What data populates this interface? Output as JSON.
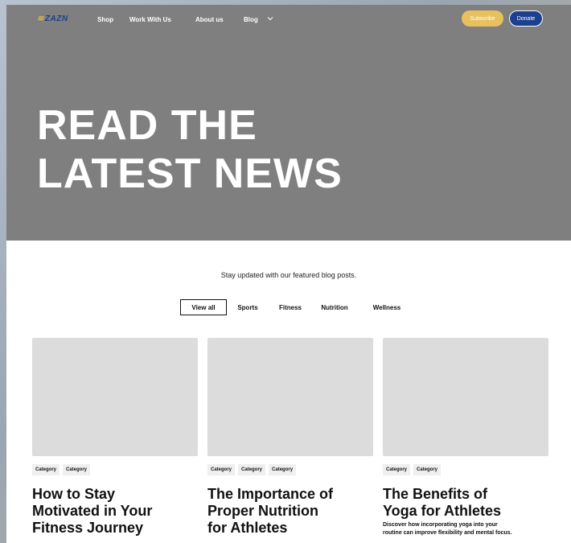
{
  "nav": {
    "logo_text": "ZAZN",
    "links": [
      "Shop",
      "Work With Us",
      "About us",
      "Blog"
    ],
    "subscribe_label": "Subscribe",
    "donate_label": "Donate"
  },
  "hero": {
    "title_line1": "READ THE",
    "title_line2": "LATEST NEWS"
  },
  "tagline": "Stay updated with our featured blog posts.",
  "filters": [
    "View all",
    "Sports",
    "Fitness",
    "Nutrition",
    "Wellness"
  ],
  "cards": [
    {
      "tags": [
        "Category",
        "Category"
      ],
      "title_lines": [
        "How to Stay",
        "Motivated in Your",
        "Fitness Journey"
      ]
    },
    {
      "tags": [
        "Category",
        "Category",
        "Category"
      ],
      "title_lines": [
        "The Importance of",
        "Proper Nutrition",
        "for Athletes"
      ]
    },
    {
      "tags": [
        "Category",
        "Category"
      ],
      "title_lines": [
        "The Benefits of",
        "Yoga for Athletes"
      ],
      "desc_lines": [
        "Discover how incorporating yoga into your",
        "routine can improve flexibility and mental focus."
      ]
    }
  ],
  "colors": {
    "hero_bg": "#7f7f7f",
    "subscribe_bg": "#e8c15e",
    "donate_bg": "#1d3f8f",
    "card_placeholder": "#dcdcdc"
  }
}
